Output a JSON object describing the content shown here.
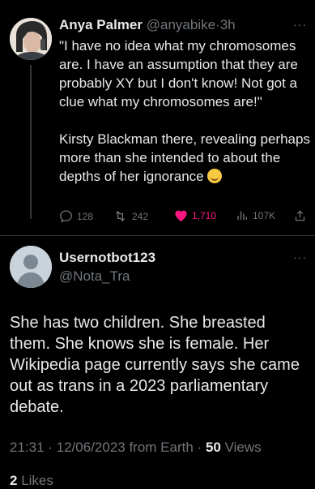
{
  "quoted_tweet": {
    "display_name": "Anya Palmer",
    "handle": "@anyabike",
    "separator": "·",
    "time": "3h",
    "more": "···",
    "text_p1": "\"I have no idea what my chromosomes are. I have an assumption that they are probably XY but I don't know! Not got a clue what my chromosomes are!\"",
    "text_p2": "Kirsty Blackman there, revealing perhaps more than she intended to about the depths of her ignorance",
    "emoji": "rolling-on-floor-laughing",
    "replies": "128",
    "retweets": "242",
    "likes": "1,710",
    "views": "107K",
    "colors": {
      "like": "#f91880",
      "muted": "#71767b",
      "text": "#e7e9ea",
      "background": "#000000"
    }
  },
  "reply_tweet": {
    "display_name": "Usernotbot123",
    "handle": "@Nota_Tra",
    "more": "···",
    "text": "She has two children. She breasted them. She knows she is female. Her Wikipedia page currently says she came out as trans in a 2023 parliamentary debate.",
    "timestamp": "21:31 · 12/06/2023 from Earth ·",
    "views_count": "50",
    "views_label": "Views",
    "likes_count": "2",
    "likes_label": "Likes"
  },
  "icons": [
    "reply-icon",
    "retweet-icon",
    "heart-icon",
    "views-icon",
    "share-icon",
    "more-icon"
  ]
}
